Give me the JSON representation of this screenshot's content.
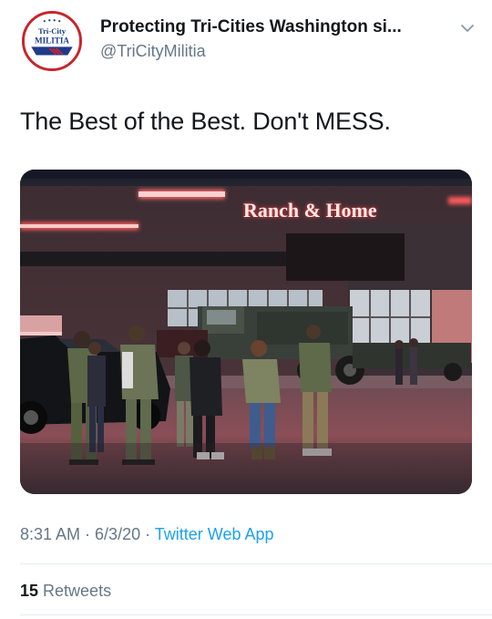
{
  "account": {
    "display_name": "Protecting Tri-Cities Washington si...",
    "handle": "@TriCityMilitia",
    "avatar_text_top": "Tri-City",
    "avatar_text_bottom": "MILITIA"
  },
  "tweet": {
    "text": "The Best of the Best. Don't MESS.",
    "image_sign_text": "Ranch & Home"
  },
  "meta": {
    "time": "8:31 AM",
    "separator": " · ",
    "date": "6/3/20",
    "app": "Twitter Web App"
  },
  "stats": {
    "retweet_count": "15",
    "retweet_label": " Retweets"
  },
  "icons": {
    "menu": "chevron-down-icon"
  },
  "colors": {
    "link": "#1da1f2",
    "muted": "#657786",
    "text": "#14171a",
    "sign": "#ff4a4a"
  }
}
